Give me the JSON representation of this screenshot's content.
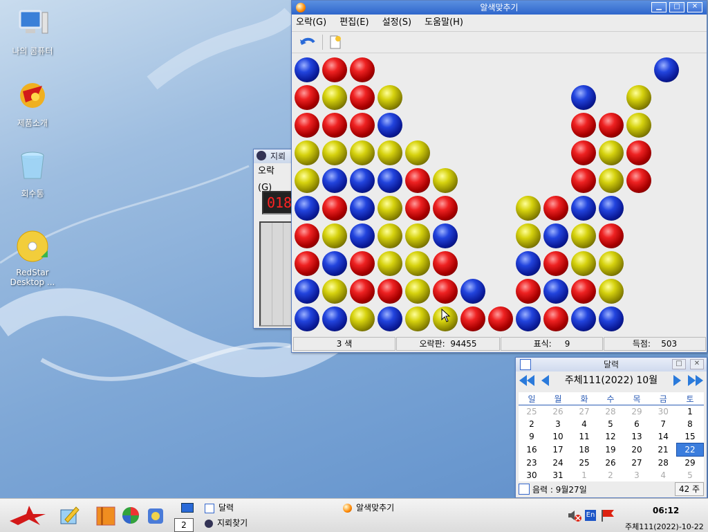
{
  "desktop": {
    "icons": [
      {
        "label": "나의 콤퓨터",
        "icon": "computer-icon"
      },
      {
        "label": "제품소개",
        "icon": "product-intro-icon"
      },
      {
        "label": "회수통",
        "icon": "trash-icon"
      },
      {
        "label": "RedStar\nDesktop ...",
        "icon": "cd-icon"
      }
    ]
  },
  "mine_window": {
    "title": "지뢰",
    "menu": "오락(G)",
    "counter": "018"
  },
  "game_window": {
    "title": "알색맞추기",
    "menu": [
      "오락(G)",
      "편집(E)",
      "설정(S)",
      "도움말(H)"
    ],
    "toolbar": [
      "undo-icon",
      "new-game-icon"
    ],
    "status": {
      "colors": "3 색",
      "board_label": "오락판:",
      "board_value": "94455",
      "marks_label": "표식:",
      "marks_value": "9",
      "score_label": "득점:",
      "score_value": "503"
    },
    "grid": [
      "BRR..........B",
      "RYRY......B.Y.",
      "RRRB......RRY.",
      "YYYYY.....RYR.",
      "YBBBRY....RYR.",
      "BRBYRR..YRBB..",
      "RYBYYB..YBYR..",
      "RBRYYR..BRYY..",
      "BYRRYRB.RBRY..",
      "BBYBYYRRBRBB.."
    ]
  },
  "calendar": {
    "title": "달력",
    "month_label": "주체111(2022) 10월",
    "weekdays": [
      "일",
      "월",
      "화",
      "수",
      "목",
      "금",
      "토"
    ],
    "weeks": [
      [
        "25",
        "26",
        "27",
        "28",
        "29",
        "30",
        "1"
      ],
      [
        "2",
        "3",
        "4",
        "5",
        "6",
        "7",
        "8"
      ],
      [
        "9",
        "10",
        "11",
        "12",
        "13",
        "14",
        "15"
      ],
      [
        "16",
        "17",
        "18",
        "19",
        "20",
        "21",
        "22"
      ],
      [
        "23",
        "24",
        "25",
        "26",
        "27",
        "28",
        "29"
      ],
      [
        "30",
        "31",
        "1",
        "2",
        "3",
        "4",
        "5"
      ]
    ],
    "selected_day": "22",
    "lunar": "음력 : 9월27일",
    "week_number": "42 주"
  },
  "taskbar": {
    "workspace": "2",
    "tasks": [
      "달력",
      "지뢰찾기",
      "알색맞추기"
    ],
    "time": "06:12",
    "date": "주체111(2022)-10-22",
    "tray": [
      "volume-muted-icon",
      "En",
      "flag-icon"
    ]
  }
}
